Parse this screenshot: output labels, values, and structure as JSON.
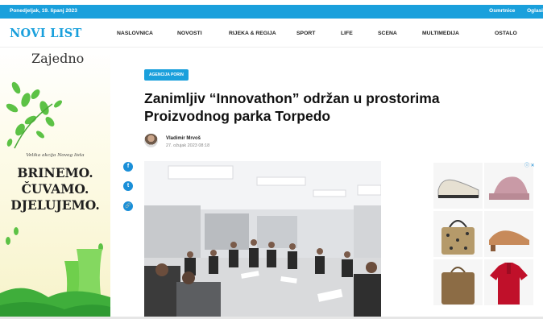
{
  "topbar": {
    "date": "Ponedjeljak, 19. lipanj 2023",
    "links": [
      "Osmrtnice",
      "Oglasi"
    ]
  },
  "header": {
    "logo": "NOVI LIST",
    "menu": [
      "NASLOVNICA",
      "NOVOSTI",
      "RIJEKA & REGIJA",
      "SPORT",
      "LIFE",
      "SCENA",
      "MULTIMEDIJA",
      "OSTALO"
    ]
  },
  "left_ad": {
    "title": "Zajedno",
    "subtitle": "Velika akcija Novog lista",
    "lines": [
      "BRINEMO.",
      "ČUVAMO.",
      "DJELUJEMO."
    ]
  },
  "social": {
    "facebook": "f",
    "twitter": "t",
    "link": "🔗"
  },
  "article": {
    "category": "AGENCIJA PORIN",
    "title": "Zanimljiv “Innovathon” održan u prostorima Proizvodnog parka Torpedo",
    "author": "Vladimir Mrvoš",
    "date": "27. ožujak 2023 08:18"
  },
  "right_ad": {
    "adchoices": "ⓘ ✕"
  },
  "colors": {
    "accent": "#1aa0dc",
    "social": "#1a8fd8"
  }
}
